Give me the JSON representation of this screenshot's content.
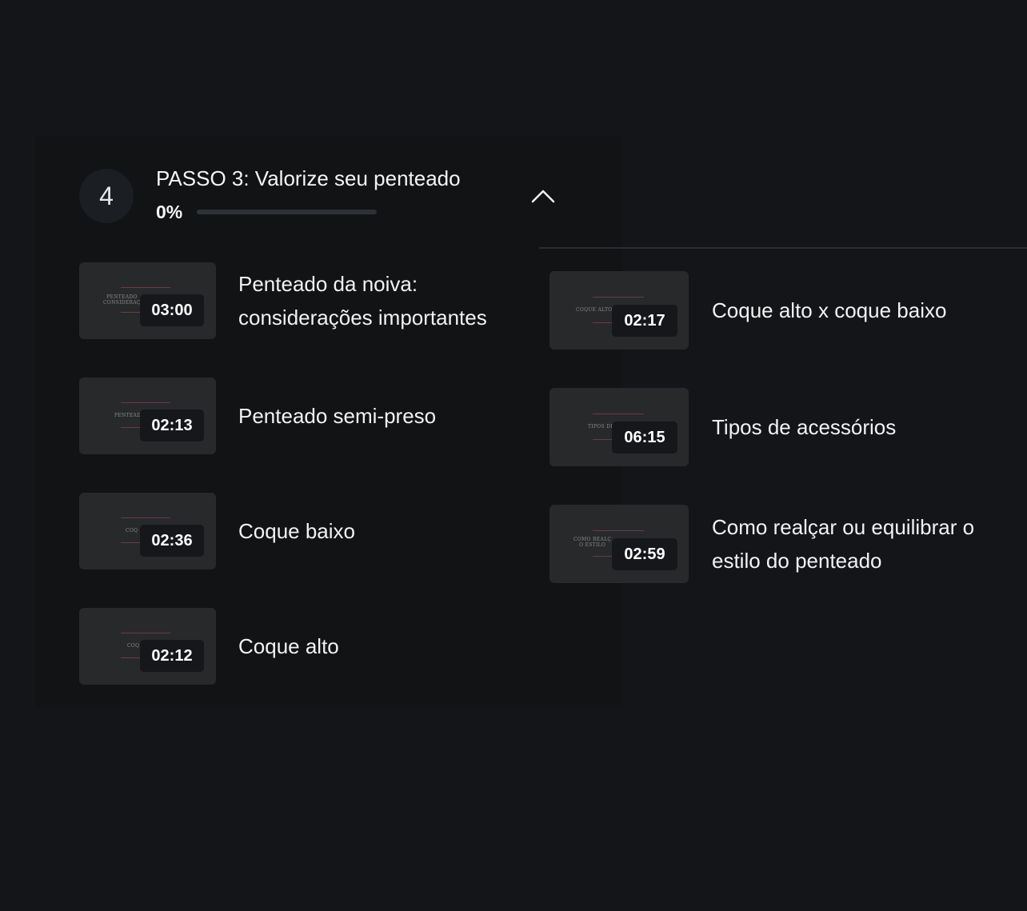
{
  "module": {
    "number": "4",
    "title": "PASSO 3: Valorize seu penteado",
    "progress_label": "0%",
    "progress_value": 0
  },
  "lessons_left": [
    {
      "title_line1": "Penteado da noiva:",
      "title_line2": "considerações importantes",
      "duration": "03:00",
      "thumb_line1": "PENTEADO",
      "thumb_line2": "CONSIDERAÇ"
    },
    {
      "title_line1": "Penteado semi-preso",
      "title_line2": "",
      "duration": "02:13",
      "thumb_line1": "PENTEADO",
      "thumb_line2": ""
    },
    {
      "title_line1": "Coque baixo",
      "title_line2": "",
      "duration": "02:36",
      "thumb_line1": "COQ",
      "thumb_line2": ""
    },
    {
      "title_line1": "Coque alto",
      "title_line2": "",
      "duration": "02:12",
      "thumb_line1": "COQ",
      "thumb_line2": ""
    }
  ],
  "lessons_right": [
    {
      "title_line1": "Coque alto x coque baixo",
      "title_line2": "",
      "duration": "02:17",
      "thumb_line1": "COQUE ALTO",
      "thumb_line2": ""
    },
    {
      "title_line1": "Tipos de acessórios",
      "title_line2": "",
      "duration": "06:15",
      "thumb_line1": "TIPOS DE",
      "thumb_line2": ""
    },
    {
      "title_line1": "Como realçar ou equilibrar o",
      "title_line2": "estilo do penteado",
      "duration": "02:59",
      "thumb_line1": "COMO REALÇ",
      "thumb_line2": "O ESTILO"
    }
  ],
  "colors": {
    "background": "#131518",
    "panel": "#111315",
    "thumbnail": "#28292b",
    "accent_line": "#6e3a42"
  },
  "icons": {
    "collapse": "chevron-up-icon"
  }
}
